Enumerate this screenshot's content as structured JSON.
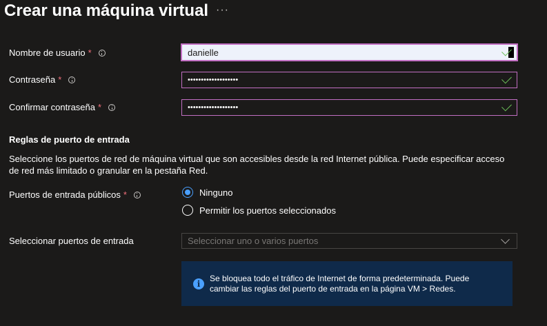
{
  "header": {
    "title": "Crear una máquina virtual",
    "more": "···"
  },
  "form": {
    "username": {
      "label": "Nombre de usuario",
      "required": "*",
      "value": "danielle"
    },
    "password": {
      "label": "Contraseña",
      "required": "*",
      "value": "•••••••••••••••••••"
    },
    "confirm_password": {
      "label": "Confirmar contraseña",
      "required": "*",
      "value": "•••••••••••••••••••"
    }
  },
  "inbound": {
    "heading": "Reglas de puerto de entrada",
    "description": "Seleccione los puertos de red de máquina virtual que son accesibles desde la red Internet pública. Puede especificar acceso de red más limitado o granular en la pestaña Red.",
    "public_ports": {
      "label": "Puertos de entrada públicos",
      "required": "*",
      "options": [
        {
          "label": "Ninguno",
          "selected": true
        },
        {
          "label": "Permitir los puertos seleccionados",
          "selected": false
        }
      ]
    },
    "select_ports": {
      "label": "Seleccionar puertos de entrada",
      "placeholder": "Seleccionar uno o varios puertos"
    },
    "info_message": "Se bloquea todo el tráfico de Internet de forma predeterminada. Puede cambiar las reglas del puerto de entrada en la página VM > Redes."
  },
  "colors": {
    "background": "#1b1a19",
    "required": "#f1707b",
    "focus_border": "#c36fc4",
    "valid_check": "#6bbf59",
    "accent": "#4aa0ff",
    "info_bg": "#0f2a4a"
  },
  "icons": {
    "more": "ellipsis-icon",
    "info": "info-circle-icon",
    "check": "checkmark-icon",
    "chevron": "chevron-down-icon",
    "info_filled": "info-filled-icon"
  }
}
